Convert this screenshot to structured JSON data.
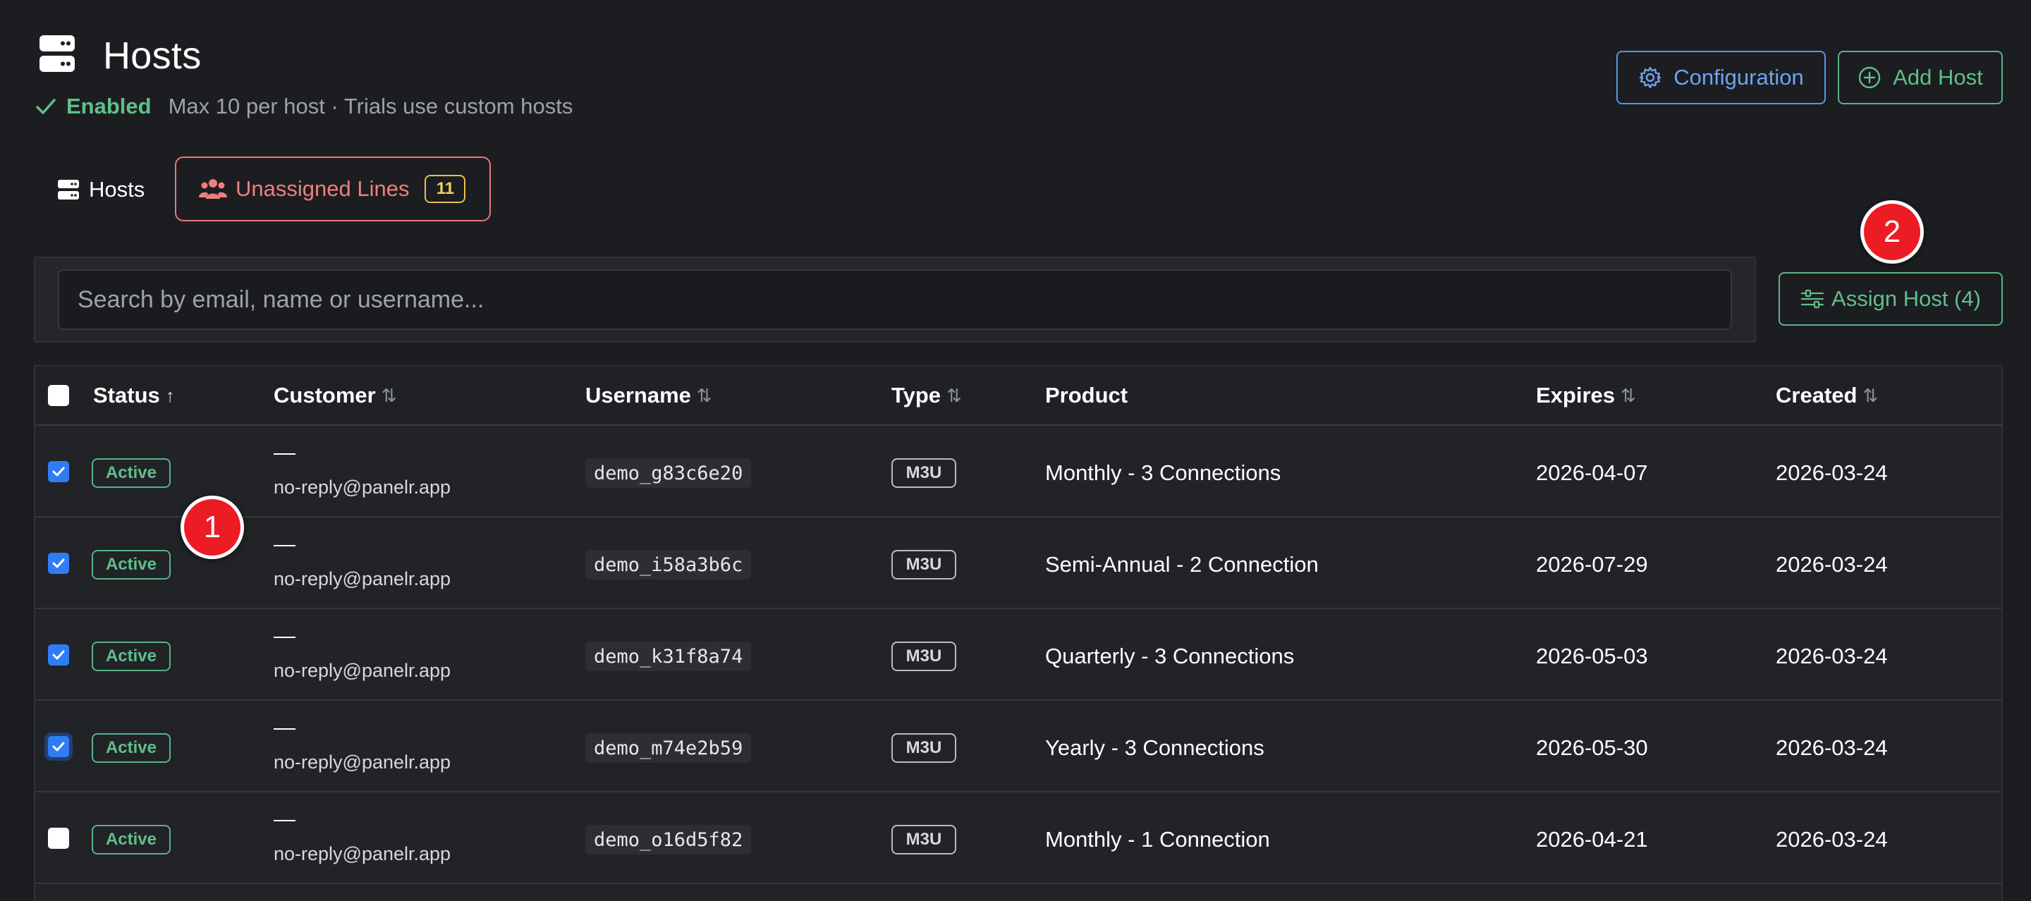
{
  "header": {
    "title": "Hosts",
    "status_label": "Enabled",
    "status_sub": "Max 10 per host · Trials use custom hosts",
    "config_label": "Configuration",
    "add_host_label": "Add Host"
  },
  "tabs": {
    "hosts_label": "Hosts",
    "unassigned_label": "Unassigned Lines",
    "unassigned_count": "11"
  },
  "search": {
    "placeholder": "Search by email, name or username...",
    "value": ""
  },
  "assign_button": "Assign Host (4)",
  "markers": [
    "1",
    "2"
  ],
  "table": {
    "columns": {
      "status": "Status",
      "customer": "Customer",
      "username": "Username",
      "type": "Type",
      "product": "Product",
      "expires": "Expires",
      "created": "Created"
    },
    "sort_active": "↑",
    "sort_inactive": "⇅",
    "rows": [
      {
        "checked": true,
        "status": "Active",
        "name": "—",
        "email": "no-reply@panelr.app",
        "username": "demo_g83c6e20",
        "type": "M3U",
        "product": "Monthly - 3 Connections",
        "expires": "2026-04-07",
        "created": "2026-03-24"
      },
      {
        "checked": true,
        "status": "Active",
        "name": "—",
        "email": "no-reply@panelr.app",
        "username": "demo_i58a3b6c",
        "type": "M3U",
        "product": "Semi-Annual - 2 Connection",
        "expires": "2026-07-29",
        "created": "2026-03-24"
      },
      {
        "checked": true,
        "status": "Active",
        "name": "—",
        "email": "no-reply@panelr.app",
        "username": "demo_k31f8a74",
        "type": "M3U",
        "product": "Quarterly - 3 Connections",
        "expires": "2026-05-03",
        "created": "2026-03-24"
      },
      {
        "checked": true,
        "status": "Active",
        "name": "—",
        "email": "no-reply@panelr.app",
        "username": "demo_m74e2b59",
        "type": "M3U",
        "product": "Yearly - 3 Connections",
        "expires": "2026-05-30",
        "created": "2026-03-24"
      },
      {
        "checked": false,
        "status": "Active",
        "name": "—",
        "email": "no-reply@panelr.app",
        "username": "demo_o16d5f82",
        "type": "M3U",
        "product": "Monthly - 1 Connection",
        "expires": "2026-04-21",
        "created": "2026-03-24"
      }
    ]
  },
  "colors": {
    "accent_green": "#5fbf8a",
    "accent_blue": "#6ea4ef",
    "accent_red": "#ef7f7c",
    "badge_yellow": "#f0cf5c",
    "checkbox_blue": "#2f7cf6",
    "marker_red": "#ec1c24"
  },
  "icons": {
    "title": "server-icon",
    "status": "check-icon",
    "config": "gear-icon",
    "add_host": "plus-circle-icon",
    "tab_hosts": "server-icon",
    "tab_unassigned": "users-icon",
    "assign": "sliders-icon"
  }
}
